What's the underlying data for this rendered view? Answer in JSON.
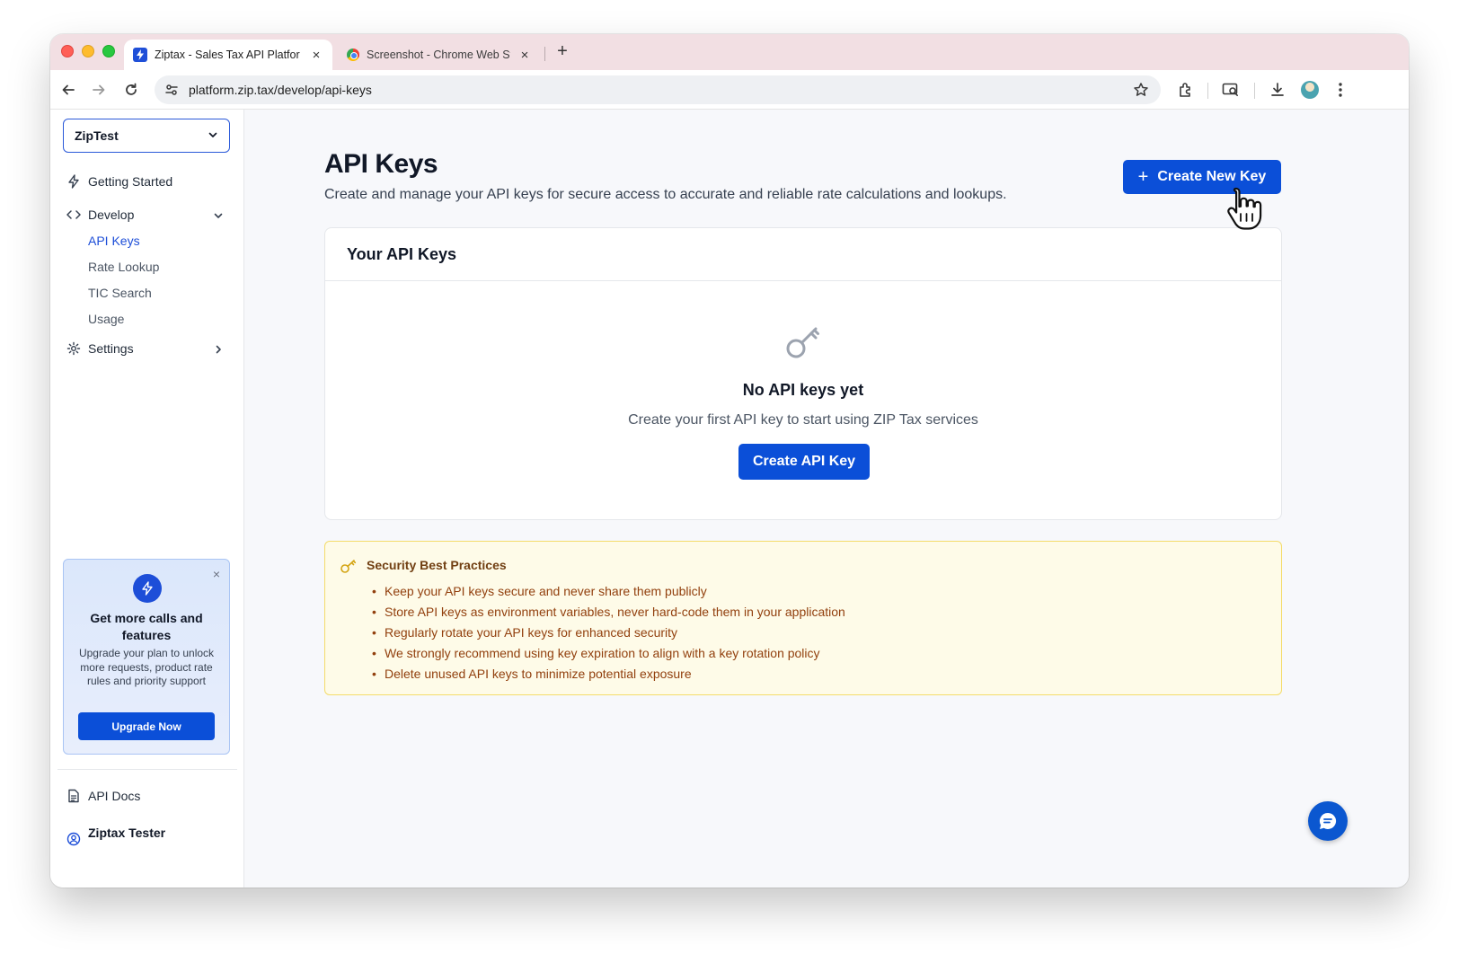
{
  "browser": {
    "tabs": [
      {
        "title": "Ziptax - Sales Tax API Platfor",
        "active": true
      },
      {
        "title": "Screenshot - Chrome Web St",
        "active": false
      }
    ],
    "new_tab_label": "+",
    "url": "platform.zip.tax/develop/api-keys"
  },
  "sidebar": {
    "workspace": "ZipTest",
    "nav": {
      "getting_started": "Getting Started",
      "develop": "Develop",
      "develop_items": [
        "API Keys",
        "Rate Lookup",
        "TIC Search",
        "Usage"
      ],
      "settings": "Settings"
    },
    "promo": {
      "title": "Get more calls and features",
      "text": "Upgrade your plan to unlock more requests, product rate rules and priority support",
      "button": "Upgrade Now",
      "close": "×"
    },
    "footer": {
      "api_docs": "API Docs",
      "user_name": "Ziptax Tester"
    }
  },
  "main": {
    "title": "API Keys",
    "subtitle": "Create and manage your API keys for secure access to accurate and reliable rate calculations and lookups.",
    "create_new_button": "Create New Key",
    "create_new_plus": "+",
    "keys_card": {
      "header": "Your API Keys",
      "empty_title": "No API keys yet",
      "empty_text": "Create your first API key to start using ZIP Tax services",
      "create_button": "Create API Key"
    },
    "security": {
      "title": "Security Best Practices",
      "items": [
        "Keep your API keys secure and never share them publicly",
        "Store API keys as environment variables, never hard-code them in your application",
        "Regularly rotate your API keys for enhanced security",
        "We strongly recommend using key expiration to align with a key rotation policy",
        "Delete unused API keys to minimize potential exposure"
      ]
    }
  },
  "colors": {
    "primary": "#0b4fd8",
    "active_nav": "#1d4ed8",
    "security_bg": "#fefbe8",
    "security_border": "#f4dc6a",
    "security_text": "#92400e",
    "tabstrip": "#f2dfe3"
  },
  "icons": {
    "create_new": "plus-icon",
    "empty_state": "key-icon",
    "security": "key-icon",
    "promo": "bolt-icon",
    "chat": "chat-icon",
    "cursor": "hand-pointer-icon"
  }
}
